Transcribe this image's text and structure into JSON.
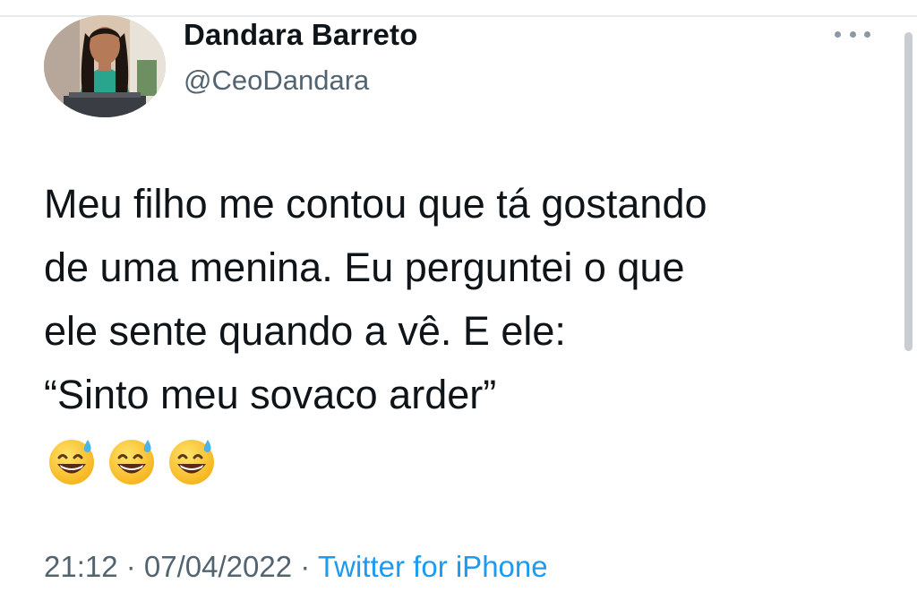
{
  "author": {
    "display_name": "Dandara Barreto",
    "handle": "@CeoDandara"
  },
  "tweet": {
    "lines": [
      "Meu filho me contou que tá gostando",
      "de uma menina. Eu perguntei o que",
      "ele sente quando a vê. E ele:",
      "“Sinto meu sovaco arder”"
    ],
    "emojis": [
      "grinning-face-with-sweat",
      "grinning-face-with-sweat",
      "grinning-face-with-sweat"
    ]
  },
  "meta": {
    "time": "21:12",
    "separator_1": " · ",
    "date": "07/04/2022",
    "separator_2": " · ",
    "source": "Twitter for iPhone"
  },
  "icons": {
    "more": "more-horizontal-icon"
  },
  "colors": {
    "text_primary": "#0f1419",
    "text_secondary": "#536471",
    "link": "#1d9bf0",
    "divider": "#e7e9ea"
  }
}
